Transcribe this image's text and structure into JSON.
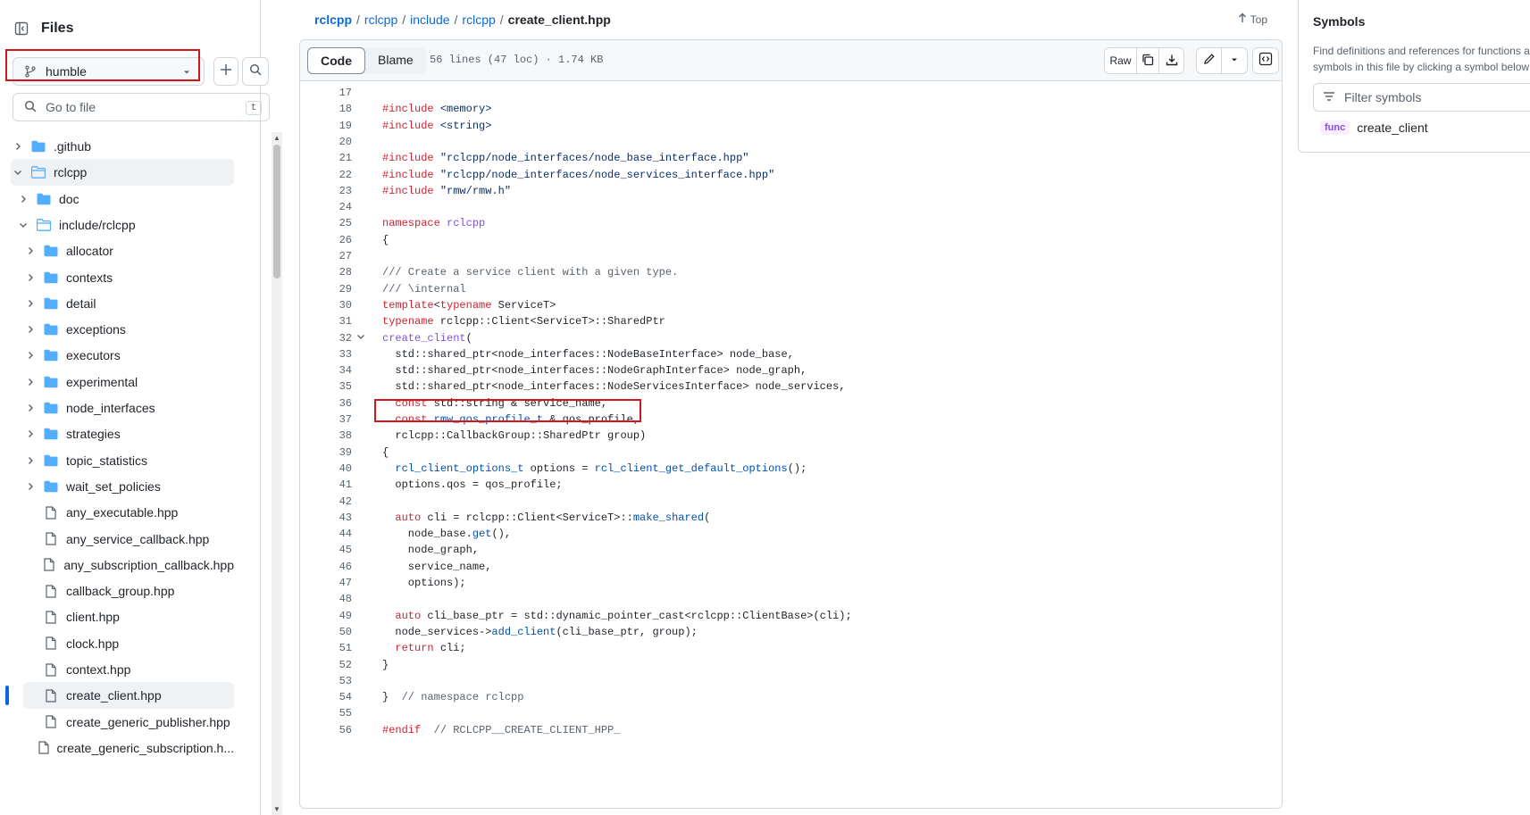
{
  "sidebar": {
    "title": "Files",
    "branch": "humble",
    "goto_placeholder": "Go to file",
    "goto_shortcut": "t",
    "tree": [
      {
        "label": ".github",
        "type": "folder",
        "depth": 0,
        "expanded": false
      },
      {
        "label": "rclcpp",
        "type": "folder",
        "depth": 0,
        "expanded": true,
        "selected": true
      },
      {
        "label": "doc",
        "type": "folder",
        "depth": 1,
        "expanded": false
      },
      {
        "label": "include/rclcpp",
        "type": "folder",
        "depth": 1,
        "expanded": true
      },
      {
        "label": "allocator",
        "type": "folder",
        "depth": 2,
        "expanded": false
      },
      {
        "label": "contexts",
        "type": "folder",
        "depth": 2,
        "expanded": false
      },
      {
        "label": "detail",
        "type": "folder",
        "depth": 2,
        "expanded": false
      },
      {
        "label": "exceptions",
        "type": "folder",
        "depth": 2,
        "expanded": false
      },
      {
        "label": "executors",
        "type": "folder",
        "depth": 2,
        "expanded": false
      },
      {
        "label": "experimental",
        "type": "folder",
        "depth": 2,
        "expanded": false
      },
      {
        "label": "node_interfaces",
        "type": "folder",
        "depth": 2,
        "expanded": false
      },
      {
        "label": "strategies",
        "type": "folder",
        "depth": 2,
        "expanded": false
      },
      {
        "label": "topic_statistics",
        "type": "folder",
        "depth": 2,
        "expanded": false
      },
      {
        "label": "wait_set_policies",
        "type": "folder",
        "depth": 2,
        "expanded": false
      },
      {
        "label": "any_executable.hpp",
        "type": "file",
        "depth": 2
      },
      {
        "label": "any_service_callback.hpp",
        "type": "file",
        "depth": 2
      },
      {
        "label": "any_subscription_callback.hpp",
        "type": "file",
        "depth": 2
      },
      {
        "label": "callback_group.hpp",
        "type": "file",
        "depth": 2
      },
      {
        "label": "client.hpp",
        "type": "file",
        "depth": 2
      },
      {
        "label": "clock.hpp",
        "type": "file",
        "depth": 2
      },
      {
        "label": "context.hpp",
        "type": "file",
        "depth": 2
      },
      {
        "label": "create_client.hpp",
        "type": "file",
        "depth": 2,
        "active": true
      },
      {
        "label": "create_generic_publisher.hpp",
        "type": "file",
        "depth": 2
      },
      {
        "label": "create_generic_subscription.h...",
        "type": "file",
        "depth": 2
      }
    ]
  },
  "breadcrumb": {
    "parts": [
      "rclcpp",
      "rclcpp",
      "include",
      "rclcpp"
    ],
    "separator": "/",
    "current": "create_client.hpp"
  },
  "top_label": "Top",
  "file_header": {
    "tab_code": "Code",
    "tab_blame": "Blame",
    "meta": "56 lines (47 loc) · 1.74 KB",
    "raw_label": "Raw"
  },
  "code_lines": [
    {
      "n": "17",
      "html": ""
    },
    {
      "n": "18",
      "html": "<span class='k'>#include</span> <span class='s'>&lt;memory&gt;</span>"
    },
    {
      "n": "19",
      "html": "<span class='k'>#include</span> <span class='s'>&lt;string&gt;</span>"
    },
    {
      "n": "20",
      "html": ""
    },
    {
      "n": "21",
      "html": "<span class='k'>#include</span> <span class='s'>\"rclcpp/node_interfaces/node_base_interface.hpp\"</span>"
    },
    {
      "n": "22",
      "html": "<span class='k'>#include</span> <span class='s'>\"rclcpp/node_interfaces/node_services_interface.hpp\"</span>"
    },
    {
      "n": "23",
      "html": "<span class='k'>#include</span> <span class='s'>\"rmw/rmw.h\"</span>"
    },
    {
      "n": "24",
      "html": ""
    },
    {
      "n": "25",
      "html": "<span class='k'>namespace</span> <span class='f'>rclcpp</span>"
    },
    {
      "n": "26",
      "html": "{"
    },
    {
      "n": "27",
      "html": ""
    },
    {
      "n": "28",
      "html": "<span class='c'>/// Create a service client with a given type.</span>"
    },
    {
      "n": "29",
      "html": "<span class='c'>/// \\internal</span>"
    },
    {
      "n": "30",
      "html": "<span class='k'>template</span>&lt;<span class='k'>typename</span> ServiceT&gt;"
    },
    {
      "n": "31",
      "html": "<span class='k'>typename</span> rclcpp::Client&lt;ServiceT&gt;::SharedPtr"
    },
    {
      "n": "32",
      "html": "<span class='f'>create_client</span>(",
      "fold": true
    },
    {
      "n": "33",
      "html": "  std::shared_ptr&lt;node_interfaces::NodeBaseInterface&gt; node_base,"
    },
    {
      "n": "34",
      "html": "  std::shared_ptr&lt;node_interfaces::NodeGraphInterface&gt; node_graph,"
    },
    {
      "n": "35",
      "html": "  std::shared_ptr&lt;node_interfaces::NodeServicesInterface&gt; node_services,"
    },
    {
      "n": "36",
      "html": "  <span class='k'>const</span> std::string &amp; service_name,"
    },
    {
      "n": "37",
      "html": "  <span class='k'>const</span> <span class='e'>rmw_qos_profile_t</span> &amp; qos_profile,"
    },
    {
      "n": "38",
      "html": "  rclcpp::CallbackGroup::SharedPtr group)"
    },
    {
      "n": "39",
      "html": "{"
    },
    {
      "n": "40",
      "html": "  <span class='e'>rcl_client_options_t</span> options = <span class='e'>rcl_client_get_default_options</span>();"
    },
    {
      "n": "41",
      "html": "  options.qos = qos_profile;"
    },
    {
      "n": "42",
      "html": ""
    },
    {
      "n": "43",
      "html": "  <span class='k'>auto</span> cli = rclcpp::Client&lt;ServiceT&gt;::<span class='e'>make_shared</span>("
    },
    {
      "n": "44",
      "html": "    node_base.<span class='e'>get</span>(),"
    },
    {
      "n": "45",
      "html": "    node_graph,"
    },
    {
      "n": "46",
      "html": "    service_name,"
    },
    {
      "n": "47",
      "html": "    options);"
    },
    {
      "n": "48",
      "html": ""
    },
    {
      "n": "49",
      "html": "  <span class='k'>auto</span> cli_base_ptr = std::dynamic_pointer_cast&lt;rclcpp::ClientBase&gt;(cli);"
    },
    {
      "n": "50",
      "html": "  node_services-&gt;<span class='e'>add_client</span>(cli_base_ptr, group);"
    },
    {
      "n": "51",
      "html": "  <span class='k'>return</span> cli;"
    },
    {
      "n": "52",
      "html": "}"
    },
    {
      "n": "53",
      "html": ""
    },
    {
      "n": "54",
      "html": "}  <span class='c'>// namespace rclcpp</span>"
    },
    {
      "n": "55",
      "html": ""
    },
    {
      "n": "56",
      "html": "<span class='k'>#endif</span>  <span class='c'>// RCLCPP__CREATE_CLIENT_HPP_</span>"
    }
  ],
  "symbols": {
    "title": "Symbols",
    "desc_line1": "Find definitions and references for functions and other",
    "desc_line2": "symbols in this file by clicking a symbol below",
    "filter_placeholder": "Filter symbols",
    "items": [
      {
        "kind": "func",
        "name": "create_client"
      }
    ]
  },
  "colors": {
    "link": "#0969da",
    "keyword": "#cf222e",
    "string": "#0a3069",
    "function": "#8250df",
    "annotation": "#d0161c"
  }
}
